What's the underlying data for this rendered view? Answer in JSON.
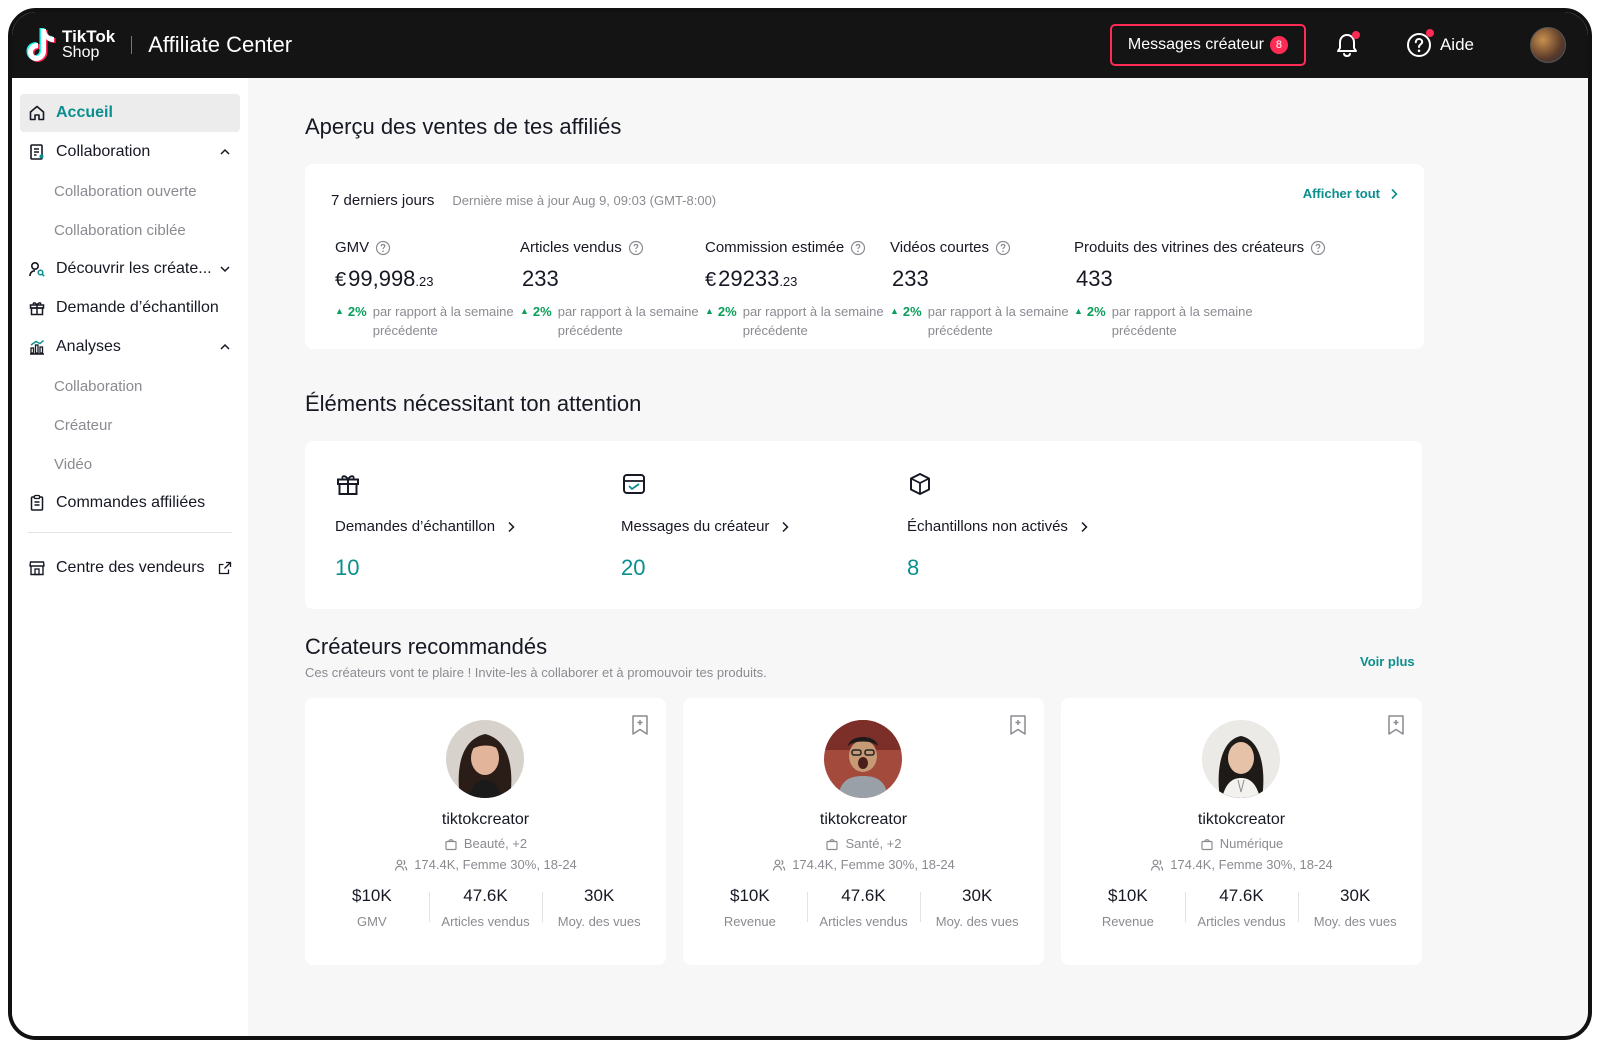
{
  "header": {
    "brand_line1": "TikTok",
    "brand_line2": "Shop",
    "app_title": "Affiliate Center",
    "messages_label": "Messages créateur",
    "messages_count": "8",
    "help_label": "Aide"
  },
  "sidebar": {
    "items": [
      {
        "label": "Accueil"
      },
      {
        "label": "Collaboration"
      },
      {
        "label": "Collaboration ouverte"
      },
      {
        "label": "Collaboration ciblée"
      },
      {
        "label": "Découvrir les créate..."
      },
      {
        "label": "Demande d’échantillon"
      },
      {
        "label": "Analyses"
      },
      {
        "label": "Collaboration"
      },
      {
        "label": "Créateur"
      },
      {
        "label": "Vidéo"
      },
      {
        "label": "Commandes affiliées"
      },
      {
        "label": "Centre des vendeurs"
      }
    ]
  },
  "sales": {
    "title": "Aperçu des ventes de tes affiliés",
    "range": "7 derniers jours",
    "updated": "Dernière mise à jour Aug 9, 09:03 (GMT-8:00)",
    "see_all": "Afficher tout",
    "metrics": [
      {
        "label": "GMV",
        "currency": "€",
        "value": "99,998",
        "decimals": ".23",
        "change": "2%",
        "change_text": "par rapport à la semaine précédente"
      },
      {
        "label": "Articles vendus",
        "currency": "",
        "value": "233",
        "decimals": "",
        "change": "2%",
        "change_text": "par rapport à la semaine précédente"
      },
      {
        "label": "Commission estimée",
        "currency": "€",
        "value": "29233",
        "decimals": ".23",
        "change": "2%",
        "change_text": "par rapport à la semaine précédente"
      },
      {
        "label": "Vidéos courtes",
        "currency": "",
        "value": "233",
        "decimals": "",
        "change": "2%",
        "change_text": "par rapport à la semaine précédente"
      },
      {
        "label": "Produits des vitrines des créateurs",
        "currency": "",
        "value": "433",
        "decimals": "",
        "change": "2%",
        "change_text": "par rapport à la semaine précédente"
      }
    ]
  },
  "attention": {
    "title": "Éléments nécessitant ton attention",
    "items": [
      {
        "label": "Demandes d’échantillon",
        "count": "10",
        "icon": "gift-icon"
      },
      {
        "label": "Messages du créateur",
        "count": "20",
        "icon": "inbox-icon"
      },
      {
        "label": "Échantillons non activés",
        "count": "8",
        "icon": "box-icon"
      }
    ]
  },
  "creators": {
    "title": "Créateurs recommandés",
    "subtitle": "Ces créateurs vont te plaire ! Invite-les à collaborer et à promouvoir tes produits.",
    "see_more": "Voir plus",
    "cards": [
      {
        "name": "tiktokcreator",
        "category": "Beauté, +2",
        "audience": "174.4K, Femme 30%, 18-24",
        "stats": [
          {
            "v": "$10K",
            "k": "GMV"
          },
          {
            "v": "47.6K",
            "k": "Articles vendus"
          },
          {
            "v": "30K",
            "k": "Moy. des vues"
          }
        ]
      },
      {
        "name": "tiktokcreator",
        "category": "Santé, +2",
        "audience": "174.4K, Femme 30%, 18-24",
        "stats": [
          {
            "v": "$10K",
            "k": "Revenue"
          },
          {
            "v": "47.6K",
            "k": "Articles vendus"
          },
          {
            "v": "30K",
            "k": "Moy. des vues"
          }
        ]
      },
      {
        "name": "tiktokcreator",
        "category": "Numérique",
        "audience": "174.4K, Femme 30%, 18-24",
        "stats": [
          {
            "v": "$10K",
            "k": "Revenue"
          },
          {
            "v": "47.6K",
            "k": "Articles vendus"
          },
          {
            "v": "30K",
            "k": "Moy. des vues"
          }
        ]
      }
    ]
  },
  "colors": {
    "accent": "#0a8e8e",
    "alert": "#fe2c55",
    "positive": "#0a9e5a",
    "topbar": "#141414"
  }
}
